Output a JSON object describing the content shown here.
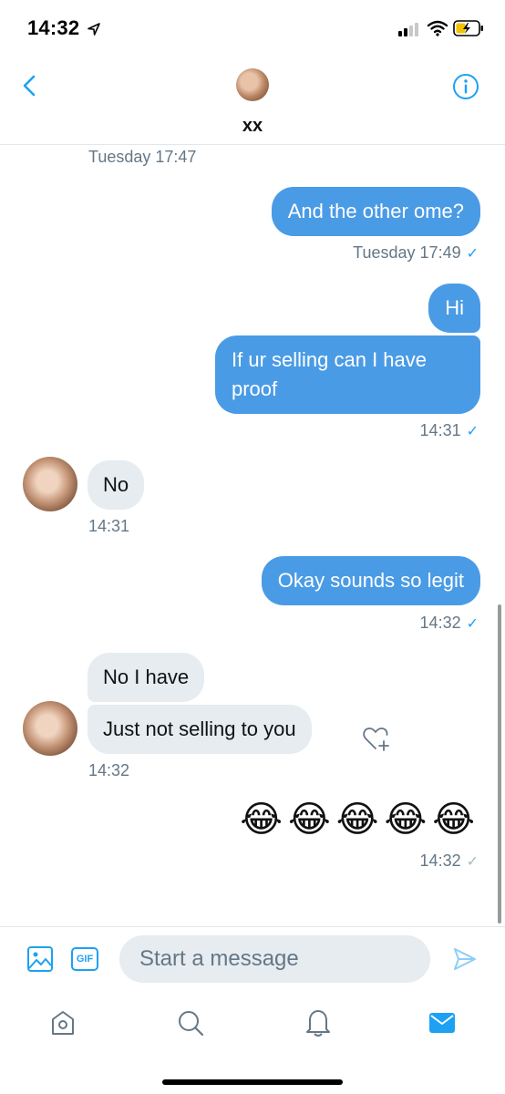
{
  "status": {
    "time": "14:32"
  },
  "header": {
    "name": "xx"
  },
  "messages": {
    "ts_top": "Tuesday 17:47",
    "m1": "And the other ome?",
    "ts_m1": "Tuesday 17:49",
    "m2": "Hi",
    "m3": "If ur selling can I have proof",
    "ts_m3": "14:31",
    "in1": "No",
    "ts_in1": "14:31",
    "m4": "Okay sounds so legit",
    "ts_m4": "14:32",
    "in2": "No I have",
    "in3": "Just not selling to you",
    "ts_in3": "14:32",
    "m5": "😂😂😂😂😂",
    "ts_m5": "14:32",
    "check": "✓"
  },
  "composer": {
    "placeholder": "Start a message",
    "gif_label": "GIF"
  },
  "colors": {
    "accent": "#1da1f2",
    "outgoing_bubble": "#4a9be5",
    "incoming_bubble": "#e6ecf0",
    "meta_text": "#657786"
  },
  "icons": [
    "location-arrow-icon",
    "signal-icon",
    "wifi-icon",
    "battery-charging-icon",
    "back-chevron-icon",
    "info-icon",
    "heart-plus-icon",
    "image-icon",
    "gif-icon",
    "send-icon",
    "home-icon",
    "search-icon",
    "bell-icon",
    "mail-icon"
  ]
}
